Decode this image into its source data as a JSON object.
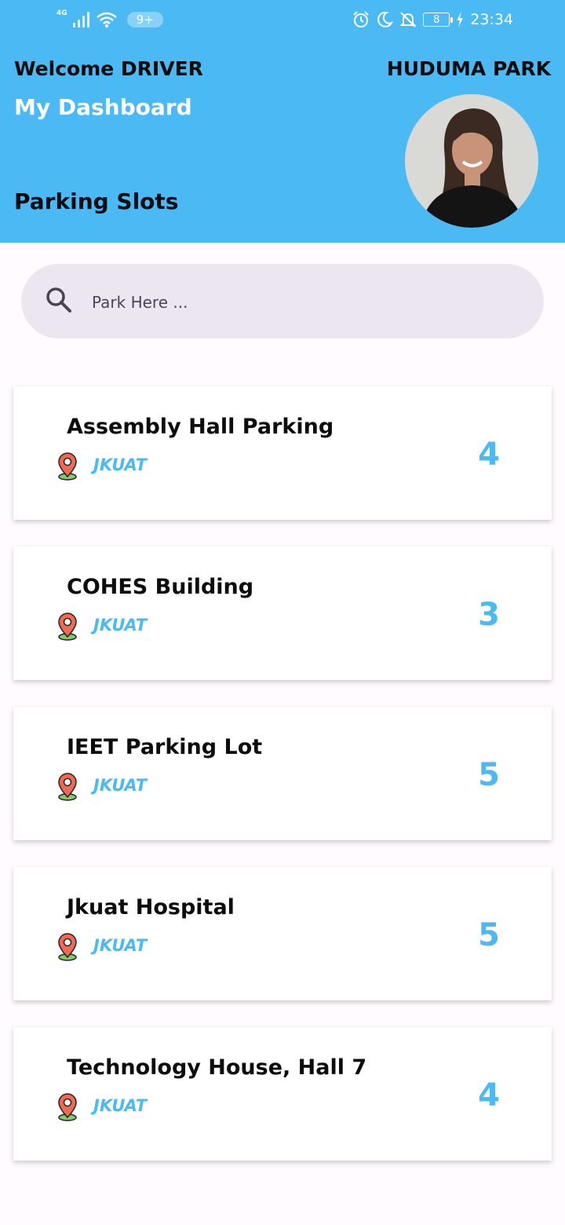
{
  "status_bar": {
    "network": "4G",
    "notification_count": "9+",
    "battery": "8",
    "time": "23:34"
  },
  "header": {
    "welcome": "Welcome DRIVER",
    "brand": "HUDUMA PARK",
    "subtitle": "My Dashboard",
    "section_title": "Parking Slots"
  },
  "search": {
    "placeholder": "Park Here ..."
  },
  "parking_list": [
    {
      "name": "Assembly Hall Parking",
      "location": "JKUAT",
      "slots": "4"
    },
    {
      "name": "COHES Building",
      "location": "JKUAT",
      "slots": "3"
    },
    {
      "name": "IEET Parking Lot",
      "location": "JKUAT",
      "slots": "5"
    },
    {
      "name": "Jkuat Hospital",
      "location": "JKUAT",
      "slots": "5"
    },
    {
      "name": "Technology House, Hall 7",
      "location": "JKUAT",
      "slots": "4"
    }
  ],
  "colors": {
    "accent": "#4bb9f3",
    "search_bg": "#ece6f1",
    "pin": "#ef6a55"
  }
}
